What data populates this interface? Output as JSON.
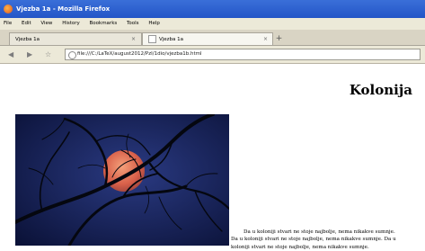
{
  "window": {
    "title": "Vjezba 1a - Mozilla Firefox"
  },
  "menu": [
    "File",
    "Edit",
    "View",
    "History",
    "Bookmarks",
    "Tools",
    "Help"
  ],
  "tabs": [
    {
      "label": "Vjezba 1a"
    },
    {
      "label": "Vjezba 1a"
    }
  ],
  "nav": {
    "url": "file:///C:/LaTeX/august2012/PzI/1dio/vjezba1b.html"
  },
  "page": {
    "heading": "Kolonija",
    "paragraph": "Da u koloniji stvari ne stoje najbolje, nema nikakve sumnje. Da u koloniji stvari ne stoje najbolje, nema nikakve sumnje. Da u koloniji stvari ne stoje najbolje, nema nikakve sumnje."
  },
  "colors": {
    "titlebar": "#2355c7",
    "chrome": "#ece9d8",
    "photo_sky": "#101a45",
    "moon": "#e8785a"
  }
}
